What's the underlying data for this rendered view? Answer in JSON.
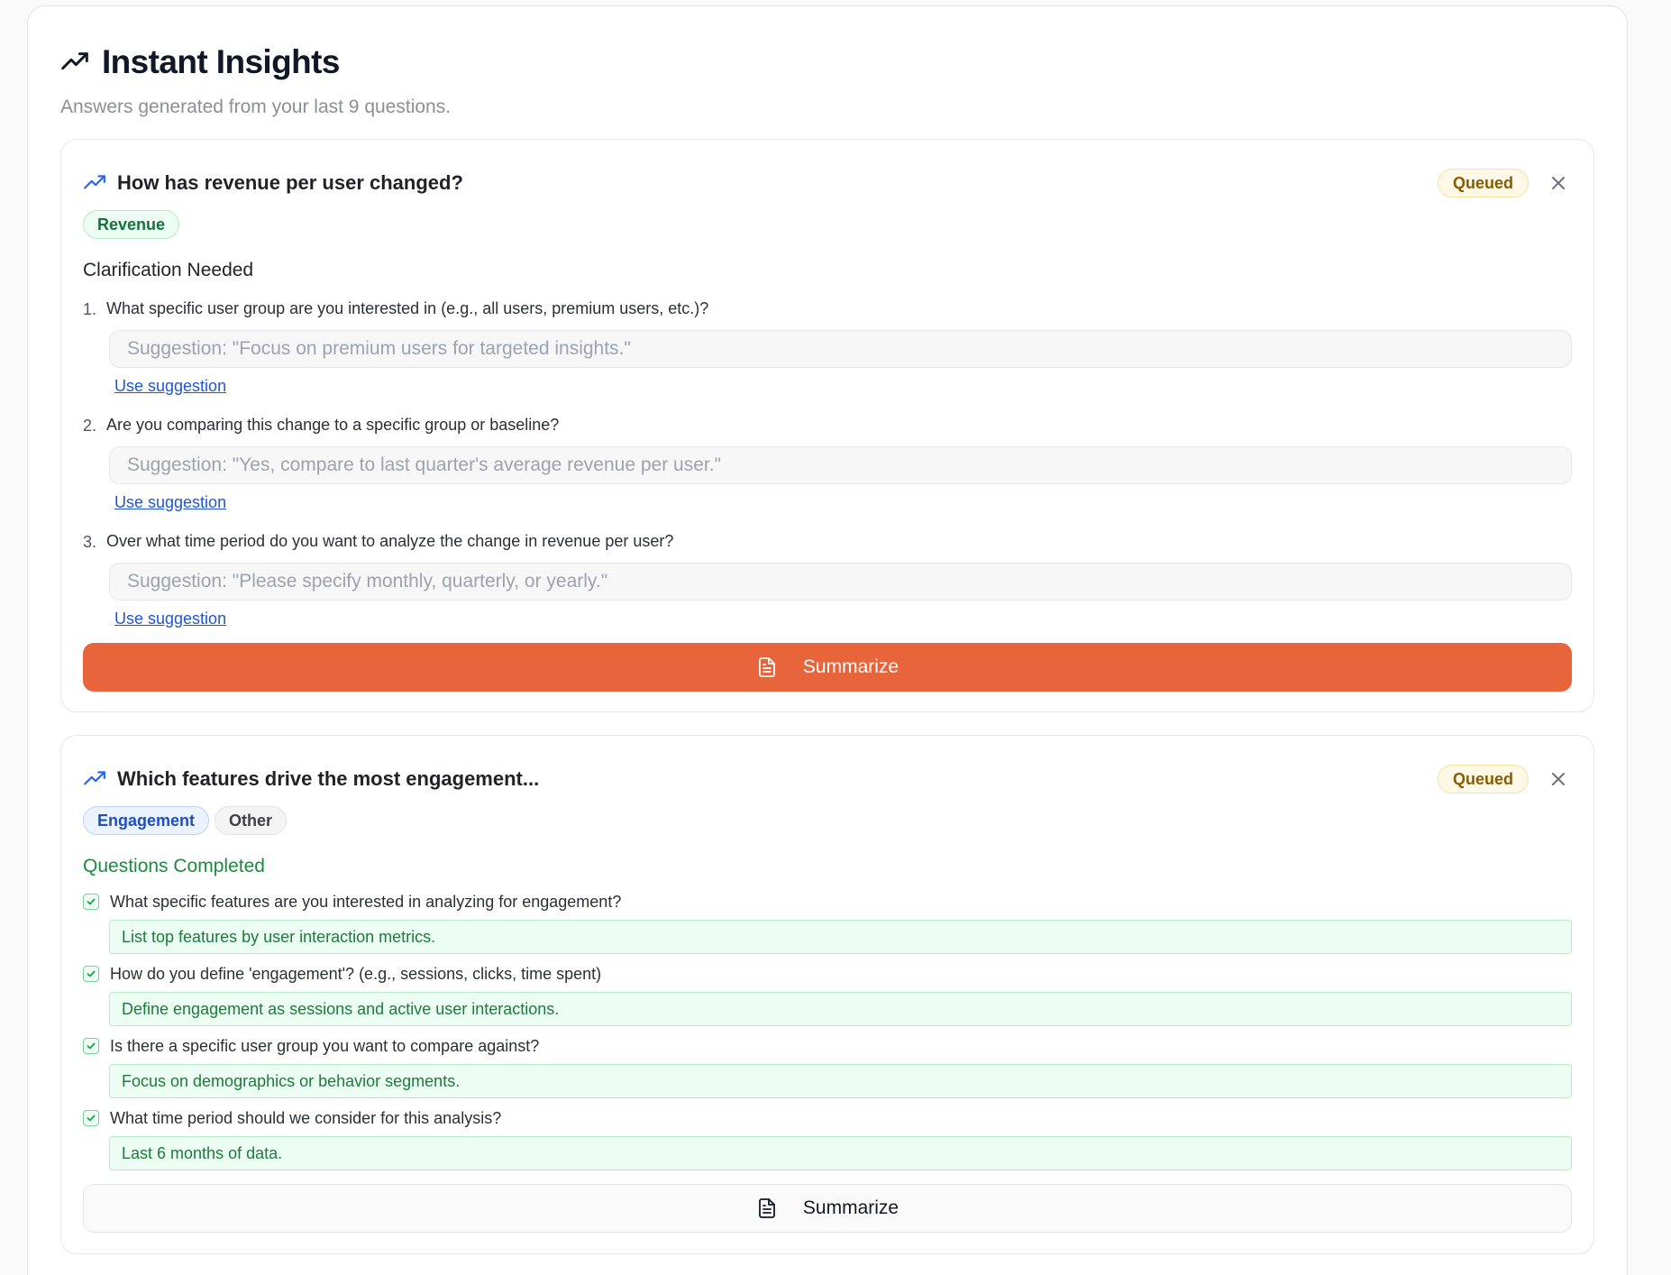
{
  "panel": {
    "title": "Instant Insights",
    "subtitle": "Answers generated from your last 9 questions.",
    "icon": "trending-up-icon"
  },
  "cards": [
    {
      "title": "How has revenue per user changed?",
      "status": "Queued",
      "tags": [
        "Revenue"
      ],
      "section_title": "Clarification Needed",
      "questions": [
        {
          "number": "1.",
          "text": "What specific user group are you interested in (e.g., all users, premium users, etc.)?",
          "placeholder": "Suggestion: \"Focus on premium users for targeted insights.\"",
          "link": "Use suggestion"
        },
        {
          "number": "2.",
          "text": "Are you comparing this change to a specific group or baseline?",
          "placeholder": "Suggestion: \"Yes, compare to last quarter's average revenue per user.\"",
          "link": "Use suggestion"
        },
        {
          "number": "3.",
          "text": "Over what time period do you want to analyze the change in revenue per user?",
          "placeholder": "Suggestion: \"Please specify monthly, quarterly, or yearly.\"",
          "link": "Use suggestion"
        }
      ],
      "button_label": "Summarize"
    },
    {
      "title": "Which features drive the most engagement...",
      "status": "Queued",
      "tags": [
        "Engagement",
        "Other"
      ],
      "section_title": "Questions Completed",
      "completed": [
        {
          "question": "What specific features are you interested in analyzing for engagement?",
          "answer": "List top features by user interaction metrics."
        },
        {
          "question": "How do you define 'engagement'? (e.g., sessions, clicks, time spent)",
          "answer": "Define engagement as sessions and active user interactions."
        },
        {
          "question": "Is there a specific user group you want to compare against?",
          "answer": "Focus on demographics or behavior segments."
        },
        {
          "question": "What time period should we consider for this analysis?",
          "answer": "Last 6 months of data."
        }
      ],
      "button_label": "Summarize"
    }
  ],
  "colors": {
    "accent_orange": "#e8643a",
    "link_blue": "#1f55d6",
    "success_green": "#1e8a3f",
    "queued_badge": "#fef9e7"
  }
}
